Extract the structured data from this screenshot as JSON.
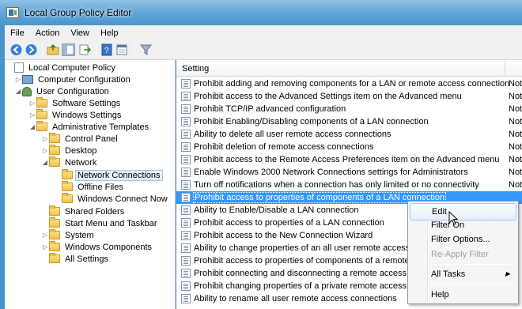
{
  "window": {
    "title": "Local Group Policy Editor"
  },
  "menubar": [
    "File",
    "Action",
    "View",
    "Help"
  ],
  "toolbar": [
    {
      "icon": "back-arrow-icon"
    },
    {
      "icon": "forward-arrow-icon"
    },
    {
      "icon": "up-folder-icon"
    },
    {
      "icon": "show-hide-tree-icon"
    },
    {
      "icon": "export-list-icon"
    },
    {
      "icon": "help-icon"
    },
    {
      "icon": "properties-view-icon"
    },
    {
      "icon": "filter-icon"
    }
  ],
  "tree": [
    {
      "label": "Local Computer Policy",
      "depth": 0,
      "expander": "",
      "icon": "policy"
    },
    {
      "label": "Computer Configuration",
      "depth": 1,
      "expander": "▷",
      "icon": "pc"
    },
    {
      "label": "User Configuration",
      "depth": 1,
      "expander": "◢",
      "icon": "user"
    },
    {
      "label": "Software Settings",
      "depth": 2,
      "expander": "▷",
      "icon": "folder"
    },
    {
      "label": "Windows Settings",
      "depth": 2,
      "expander": "▷",
      "icon": "folder"
    },
    {
      "label": "Administrative Templates",
      "depth": 2,
      "expander": "◢",
      "icon": "folder"
    },
    {
      "label": "Control Panel",
      "depth": 3,
      "expander": "▷",
      "icon": "folder"
    },
    {
      "label": "Desktop",
      "depth": 3,
      "expander": "▷",
      "icon": "folder"
    },
    {
      "label": "Network",
      "depth": 3,
      "expander": "◢",
      "icon": "folder"
    },
    {
      "label": "Network Connections",
      "depth": 4,
      "expander": "",
      "icon": "folder",
      "selected": true
    },
    {
      "label": "Offline Files",
      "depth": 4,
      "expander": "",
      "icon": "folder"
    },
    {
      "label": "Windows Connect Now",
      "depth": 4,
      "expander": "",
      "icon": "folder"
    },
    {
      "label": "Shared Folders",
      "depth": 3,
      "expander": "",
      "icon": "folder"
    },
    {
      "label": "Start Menu and Taskbar",
      "depth": 3,
      "expander": "",
      "icon": "folder"
    },
    {
      "label": "System",
      "depth": 3,
      "expander": "▷",
      "icon": "folder"
    },
    {
      "label": "Windows Components",
      "depth": 3,
      "expander": "▷",
      "icon": "folder"
    },
    {
      "label": "All Settings",
      "depth": 3,
      "expander": "",
      "icon": "folder"
    }
  ],
  "columns": {
    "setting": "Setting"
  },
  "settings": [
    {
      "name": "Prohibit adding and removing components for a LAN or remote access connection",
      "state": "Not"
    },
    {
      "name": "Prohibit access to the Advanced Settings item on the Advanced menu",
      "state": "Not"
    },
    {
      "name": "Prohibit TCP/IP advanced configuration",
      "state": "Not"
    },
    {
      "name": "Prohibit Enabling/Disabling components of a LAN connection",
      "state": "Not"
    },
    {
      "name": "Ability to delete all user remote access connections",
      "state": "Not"
    },
    {
      "name": "Prohibit deletion of remote access connections",
      "state": "Not"
    },
    {
      "name": "Prohibit access to the Remote Access Preferences item on the Advanced menu",
      "state": "Not"
    },
    {
      "name": "Enable Windows 2000 Network Connections settings for Administrators",
      "state": "Not"
    },
    {
      "name": "Turn off notifications when a connection has only limited or no connectivity",
      "state": "Not"
    },
    {
      "name": "Prohibit access to properties of components of a LAN connection",
      "state": "",
      "selected": true
    },
    {
      "name": "Ability to Enable/Disable a LAN connection",
      "state": ""
    },
    {
      "name": "Prohibit access to properties of a LAN connection",
      "state": ""
    },
    {
      "name": "Prohibit access to the New Connection Wizard",
      "state": ""
    },
    {
      "name": "Ability to change properties of an all user remote access conn",
      "state": ""
    },
    {
      "name": "Prohibit access to properties of components of a remote acce",
      "state": ""
    },
    {
      "name": "Prohibit connecting and disconnecting a remote access conne",
      "state": ""
    },
    {
      "name": "Prohibit changing properties of a private remote access conne",
      "state": ""
    },
    {
      "name": "Ability to rename all user remote access connections",
      "state": ""
    }
  ],
  "context_menu": {
    "edit": "Edit",
    "filter_on": "Filter On",
    "filter_options": "Filter Options...",
    "reapply_filter": "Re-Apply Filter",
    "all_tasks": "All Tasks",
    "help": "Help"
  }
}
